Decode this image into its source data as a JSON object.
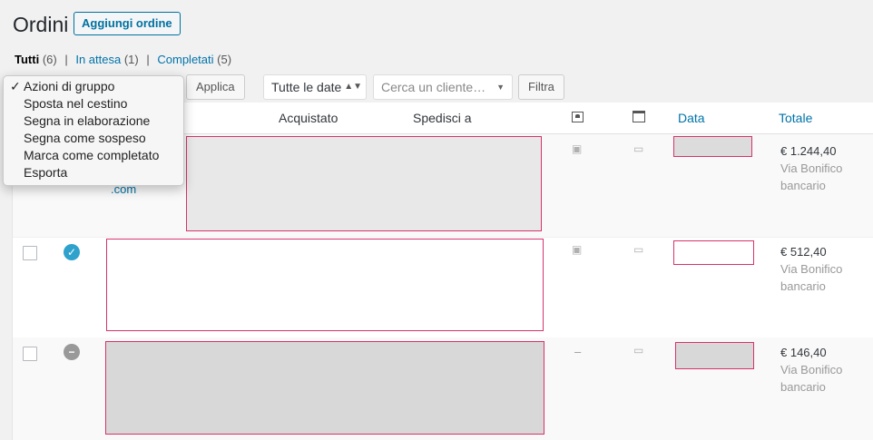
{
  "header": {
    "title": "Ordini",
    "add_label": "Aggiungi ordine"
  },
  "subsubsub": [
    {
      "label": "Tutti",
      "count": "(6)"
    },
    {
      "label": "In attesa",
      "count": "(1)"
    },
    {
      "label": "Completati",
      "count": "(5)"
    }
  ],
  "bulk": {
    "options": [
      "Azioni di gruppo",
      "Sposta nel cestino",
      "Segna in elaborazione",
      "Segna come sospeso",
      "Marca come completato",
      "Esporta"
    ],
    "selected_mark": "✓"
  },
  "toolbar": {
    "apply_label": "Applica",
    "dates_label": "Tutte le date",
    "customer_placeholder": "Cerca un cliente…",
    "filter_label": "Filtra"
  },
  "columns": {
    "purchased": "Acquistato",
    "ship_to": "Spedisci a",
    "date": "Data",
    "total": "Totale"
  },
  "rows": [
    {
      "email_fragment": ".com",
      "total": "€ 1.244,40",
      "payment_line1": "Via Bonifico",
      "payment_line2": "bancario",
      "status": "hidden"
    },
    {
      "total": "€ 512,40",
      "payment_line1": "Via Bonifico",
      "payment_line2": "bancario",
      "status": "completed",
      "status_color": "#2ea2cc"
    },
    {
      "total": "€ 146,40",
      "payment_line1": "Via Bonifico",
      "payment_line2": "bancario",
      "status": "on-hold",
      "status_color": "#999999",
      "billing": "–"
    }
  ],
  "colors": {
    "accent": "#0073aa",
    "redaction_border": "#d6336c",
    "redaction_fill": "#e8e8e8",
    "redaction_fill_dark": "#d8d8d8"
  }
}
